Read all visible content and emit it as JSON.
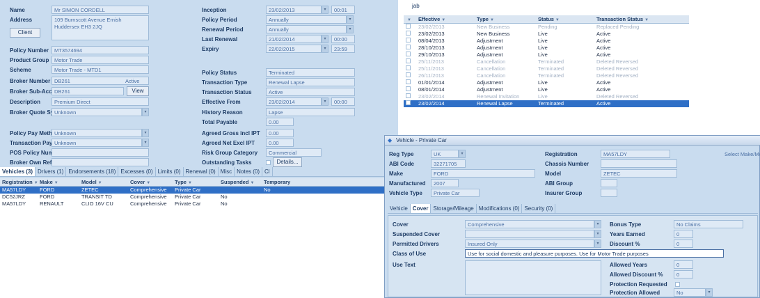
{
  "policy": {
    "name_label": "Name",
    "name": "Mr SIMON CORDELL",
    "address_label": "Address",
    "address": "109 Burnscott Avenue Ernish Huddersex EH3 2JQ",
    "client_button": "Client",
    "policy_number_label": "Policy Number",
    "policy_number": "MT3574694",
    "product_group_label": "Product Group",
    "product_group": "Motor Trade",
    "scheme_label": "Scheme",
    "scheme": "Motor Trade - MTD1",
    "broker_number_label": "Broker Number",
    "broker_number": "DB261",
    "broker_status": "Active",
    "broker_sub_label": "Broker Sub-Account",
    "broker_sub": "DB261",
    "view_button": "View",
    "description_label": "Description",
    "description": "Premium Direct",
    "quote_system_label": "Broker Quote System",
    "quote_system": "Unknown",
    "pay_method_label": "Policy Pay Method",
    "pay_method": "Unknown",
    "txn_payment_label": "Transaction Payment",
    "txn_payment": "Unknown",
    "pos_policy_label": "POS Policy Number",
    "pos_policy": "",
    "broker_own_ref_label": "Broker Own Ref",
    "broker_own_ref": ""
  },
  "policy_right": {
    "inception_label": "Inception",
    "inception_date": "23/02/2013",
    "inception_time": "00:01",
    "policy_period_label": "Policy Period",
    "policy_period": "Annually",
    "renewal_period_label": "Renewal Period",
    "renewal_period": "Annually",
    "last_renewal_label": "Last Renewal",
    "last_renewal_date": "21/02/2014",
    "last_renewal_time": "00:00",
    "expiry_label": "Expiry",
    "expiry_date": "22/02/2015",
    "expiry_time": "23:59",
    "policy_status_label": "Policy Status",
    "policy_status": "Terminated",
    "txn_type_label": "Transaction Type",
    "txn_type": "Renewal Lapse",
    "txn_status_label": "Transaction Status",
    "txn_status": "Active",
    "effective_label": "Effective From",
    "effective_date": "23/02/2014",
    "effective_time": "00:00",
    "history_reason_label": "History Reason",
    "history_reason": "Lapse",
    "total_payable_label": "Total Payable",
    "total_payable": "0.00",
    "agreed_gross_label": "Agreed Gross incl IPT",
    "agreed_gross": "0.00",
    "agreed_net_label": "Agreed Net Excl IPT",
    "agreed_net": "0.00",
    "risk_group_label": "Risk Group Category",
    "risk_group": "Commercial",
    "outstanding_label": "Outstanding Tasks",
    "details_button": "Details..."
  },
  "history": {
    "search_value": "jab",
    "columns": [
      "Effective",
      "Type",
      "Status",
      "Transaction Status"
    ],
    "rows": [
      {
        "effective": "23/02/2013",
        "type": "New Business",
        "status": "Pending",
        "txn_status": "Replaced Pending"
      },
      {
        "effective": "23/02/2013",
        "type": "New Business",
        "status": "Live",
        "txn_status": "Active"
      },
      {
        "effective": "08/04/2013",
        "type": "Adjustment",
        "status": "Live",
        "txn_status": "Active"
      },
      {
        "effective": "28/10/2013",
        "type": "Adjustment",
        "status": "Live",
        "txn_status": "Active"
      },
      {
        "effective": "29/10/2013",
        "type": "Adjustment",
        "status": "Live",
        "txn_status": "Active"
      },
      {
        "effective": "25/11/2013",
        "type": "Cancellation",
        "status": "Terminated",
        "txn_status": "Deleted Reversed"
      },
      {
        "effective": "25/11/2013",
        "type": "Cancellation",
        "status": "Terminated",
        "txn_status": "Deleted Reversed"
      },
      {
        "effective": "26/11/2013",
        "type": "Cancellation",
        "status": "Terminated",
        "txn_status": "Deleted Reversed"
      },
      {
        "effective": "01/01/2014",
        "type": "Adjustment",
        "status": "Live",
        "txn_status": "Active"
      },
      {
        "effective": "08/01/2014",
        "type": "Adjustment",
        "status": "Live",
        "txn_status": "Active"
      },
      {
        "effective": "23/02/2014",
        "type": "Renewal Invitation",
        "status": "Live",
        "txn_status": "Deleted Reversed"
      },
      {
        "effective": "23/02/2014",
        "type": "Renewal Lapse",
        "status": "Terminated",
        "txn_status": "Active"
      }
    ]
  },
  "bottom_tabs": [
    "Vehicles (3)",
    "Drivers (1)",
    "Endorsements (18)",
    "Excesses (0)",
    "Limits (0)",
    "Renewal (0)",
    "Misc",
    "Notes (0)",
    "Cl"
  ],
  "vehicles": {
    "columns": [
      "Registration",
      "Make",
      "Model",
      "Cover",
      "Type",
      "Suspended",
      "Temporary"
    ],
    "rows": [
      {
        "reg": "MA57LDY",
        "make": "FORD",
        "model": "ZETEC",
        "cover": "Comprehensive",
        "type": "Private Car",
        "suspended": "",
        "temporary": "No"
      },
      {
        "reg": "DC52JRZ",
        "make": "FORD",
        "model": "TRANSIT TD",
        "cover": "Comprehensive",
        "type": "Private Car",
        "suspended": "No",
        "temporary": ""
      },
      {
        "reg": "MA57LDY",
        "make": "RENAULT",
        "model": "CLIO 16V CU",
        "cover": "Comprehensive",
        "type": "Private Car",
        "suspended": "No",
        "temporary": ""
      }
    ]
  },
  "vehicle_window": {
    "title": "Vehicle - Private Car",
    "reg_type_label": "Reg Type",
    "reg_type": "UK",
    "abi_code_label": "ABI Code",
    "abi_code": "32271705",
    "make_label": "Make",
    "make": "FORD",
    "manufactured_label": "Manufactured",
    "manufactured": "2007",
    "vehicle_type_label": "Vehicle Type",
    "vehicle_type": "Private Car",
    "registration_label": "Registration",
    "registration": "MA57LDY",
    "chassis_label": "Chassis Number",
    "chassis": "",
    "model_label": "Model",
    "model": "ZETEC",
    "abi_group_label": "ABI Group",
    "abi_group": "",
    "insurer_group_label": "Insurer Group",
    "insurer_group": "",
    "select_make_label": "Select Make/Model",
    "tabs": [
      "Vehicle",
      "Cover",
      "Storage/Mileage",
      "Modifications (0)",
      "Security (0)"
    ],
    "cover_label": "Cover",
    "cover": "Comprehensive",
    "suspended_cover_label": "Suspended Cover",
    "suspended_cover": "",
    "permitted_drivers_label": "Permitted Drivers",
    "permitted_drivers": "Insured Only",
    "class_of_use_label": "Class of Use",
    "class_of_use": "Use for social domestic and pleasure purposes. Use for Motor Trade purposes",
    "use_text_label": "Use Text",
    "bonus_type_label": "Bonus Type",
    "bonus_type": "No Claims",
    "years_earned_label": "Years Earned",
    "years_earned": "0",
    "discount_label": "Discount %",
    "discount": "0",
    "allowed_years_label": "Allowed Years",
    "allowed_years": "0",
    "allowed_discount_label": "Allowed Discount %",
    "allowed_discount": "0",
    "protection_requested_label": "Protection Requested",
    "protection_allowed_label": "Protection Allowed",
    "protection_allowed": "No"
  }
}
